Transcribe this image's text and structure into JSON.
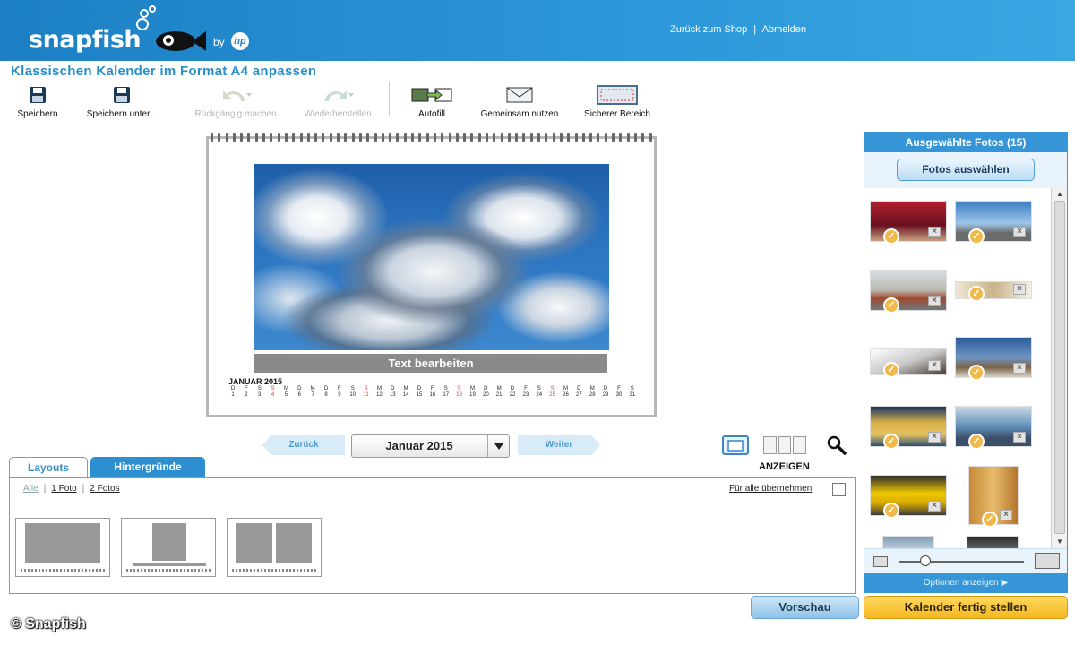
{
  "brand": {
    "logo_text": "snapfish",
    "by": "by",
    "hp": "hp"
  },
  "header_links": {
    "back_to_shop": "Zurück zum Shop",
    "separator": "|",
    "logout": "Abmelden"
  },
  "page_title": "Klassischen Kalender im Format A4 anpassen",
  "toolbar": [
    {
      "label": "Speichern",
      "icon": "save-icon",
      "enabled": true
    },
    {
      "label": "Speichern unter...",
      "icon": "save-as-icon",
      "enabled": true
    },
    {
      "label": "Rückgängig machen",
      "icon": "undo-icon",
      "enabled": false
    },
    {
      "label": "Wiederherstellen",
      "icon": "redo-icon",
      "enabled": false
    },
    {
      "label": "Autofill",
      "icon": "autofill-icon",
      "enabled": true
    },
    {
      "label": "Gemeinsam nutzen",
      "icon": "share-envelope-icon",
      "enabled": true
    },
    {
      "label": "Sicherer Bereich",
      "icon": "safe-area-icon",
      "enabled": true
    }
  ],
  "calendar": {
    "text_button": "Text bearbeiten",
    "month_label": "JANUAR 2015",
    "weekday_initials": [
      "D",
      "F",
      "S",
      "S",
      "M",
      "D",
      "M",
      "D",
      "F",
      "S",
      "S",
      "M",
      "D",
      "M",
      "D",
      "F",
      "S",
      "S",
      "M",
      "D",
      "M",
      "D",
      "F",
      "S",
      "S",
      "M",
      "D",
      "M",
      "D",
      "F",
      "S"
    ],
    "days": [
      "1",
      "2",
      "3",
      "4",
      "5",
      "6",
      "7",
      "8",
      "9",
      "10",
      "11",
      "12",
      "13",
      "14",
      "15",
      "16",
      "17",
      "18",
      "19",
      "20",
      "21",
      "22",
      "23",
      "24",
      "25",
      "26",
      "27",
      "28",
      "29",
      "30",
      "31"
    ],
    "highlight_days": [
      "4",
      "11",
      "18",
      "25"
    ]
  },
  "month_nav": {
    "prev": "Zurück",
    "current": "Januar 2015",
    "next": "Weiter"
  },
  "view": {
    "label": "ANZEIGEN"
  },
  "tabs": {
    "layouts": "Layouts",
    "backgrounds": "Hintergründe"
  },
  "filters": {
    "all": "Alle",
    "one_photo": "1 Foto",
    "two_photos": "2 Fotos",
    "separator": "|"
  },
  "apply_all": "Für alle übernehmen",
  "sidebar": {
    "title": "Ausgewählte Fotos (15)",
    "pick_button": "Fotos auswählen",
    "options": "Optionen anzeigen ▶"
  },
  "buttons": {
    "preview": "Vorschau",
    "finish": "Kalender fertig stellen"
  },
  "copyright": "© Snapfish",
  "colors": {
    "header": "#1c7fc4",
    "accent": "#3595d6",
    "finish": "#f4b820",
    "holiday": "#dd3333"
  }
}
